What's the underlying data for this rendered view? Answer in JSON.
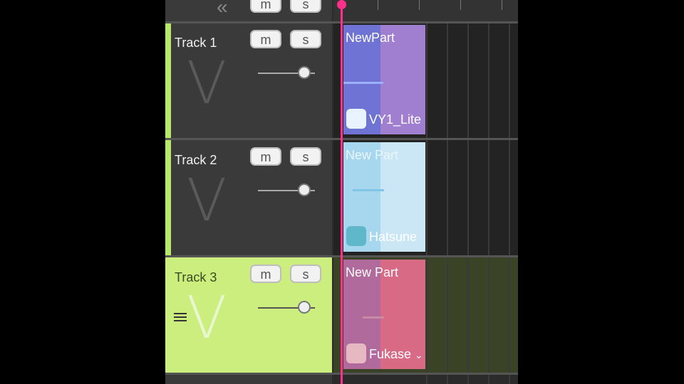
{
  "header": {
    "collapse_glyph": "«",
    "mute_label": "m",
    "solo_label": "s"
  },
  "tracks": [
    {
      "name": "Track 1",
      "mute_label": "m",
      "solo_label": "s",
      "volume": 0.82
    },
    {
      "name": "Track 2",
      "mute_label": "m",
      "solo_label": "s",
      "volume": 0.82
    },
    {
      "name": "Track 3",
      "mute_label": "m",
      "solo_label": "s",
      "volume": 0.82,
      "selected": true
    }
  ],
  "parts": [
    {
      "title": "NewPart",
      "singer": "VY1_Lite",
      "color": "#8a7fd8"
    },
    {
      "title": "New Part",
      "singer": "Hatsune",
      "color": "#bfe1f2"
    },
    {
      "title": "New Part",
      "singer": "Fukase",
      "singer_suffix": "⌄",
      "color": "#d86a86"
    }
  ],
  "colors": {
    "accent": "#b8e86a",
    "playhead": "#ff2f8a",
    "selected_track": "#cbee7f"
  },
  "icons": {
    "collapse": "double-chevron-left-icon",
    "track_menu": "hamburger-icon",
    "vocaloid": "v-logo-icon"
  }
}
